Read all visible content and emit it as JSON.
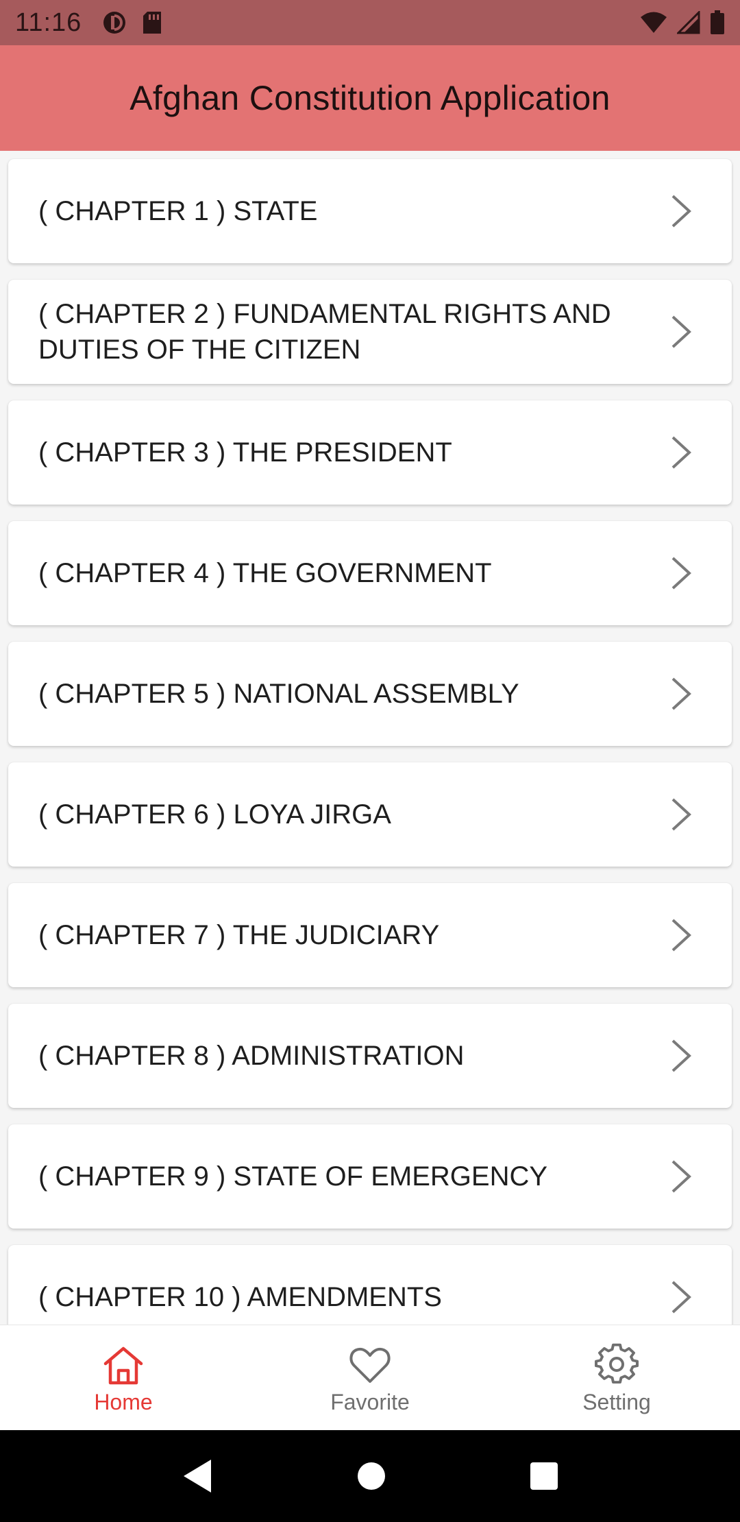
{
  "status_bar": {
    "time": "11:16",
    "icons": [
      "data-saver-icon",
      "sd-card-icon",
      "wifi-icon",
      "signal-icon",
      "battery-icon"
    ]
  },
  "app_bar": {
    "title": "Afghan Constitution Application"
  },
  "chapters": [
    {
      "label": "( CHAPTER 1 ) STATE"
    },
    {
      "label": "( CHAPTER 2 ) FUNDAMENTAL RIGHTS AND DUTIES OF THE CITIZEN"
    },
    {
      "label": "( CHAPTER 3 ) THE PRESIDENT"
    },
    {
      "label": "( CHAPTER 4 ) THE GOVERNMENT"
    },
    {
      "label": "( CHAPTER 5 ) NATIONAL ASSEMBLY"
    },
    {
      "label": "( CHAPTER 6 ) LOYA JIRGA"
    },
    {
      "label": "( CHAPTER 7 ) THE JUDICIARY"
    },
    {
      "label": "( CHAPTER 8 ) ADMINISTRATION"
    },
    {
      "label": "( CHAPTER 9 ) STATE OF EMERGENCY"
    },
    {
      "label": "( CHAPTER 10 ) AMENDMENTS"
    }
  ],
  "bottom_nav": {
    "items": [
      {
        "label": "Home",
        "icon": "home-icon",
        "active": true
      },
      {
        "label": "Favorite",
        "icon": "heart-icon",
        "active": false
      },
      {
        "label": "Setting",
        "icon": "gear-icon",
        "active": false
      }
    ]
  },
  "colors": {
    "status_bar": "#a65a5c",
    "app_bar": "#e37373",
    "active_nav": "#e53935",
    "inactive_nav": "#6f6f6f"
  }
}
